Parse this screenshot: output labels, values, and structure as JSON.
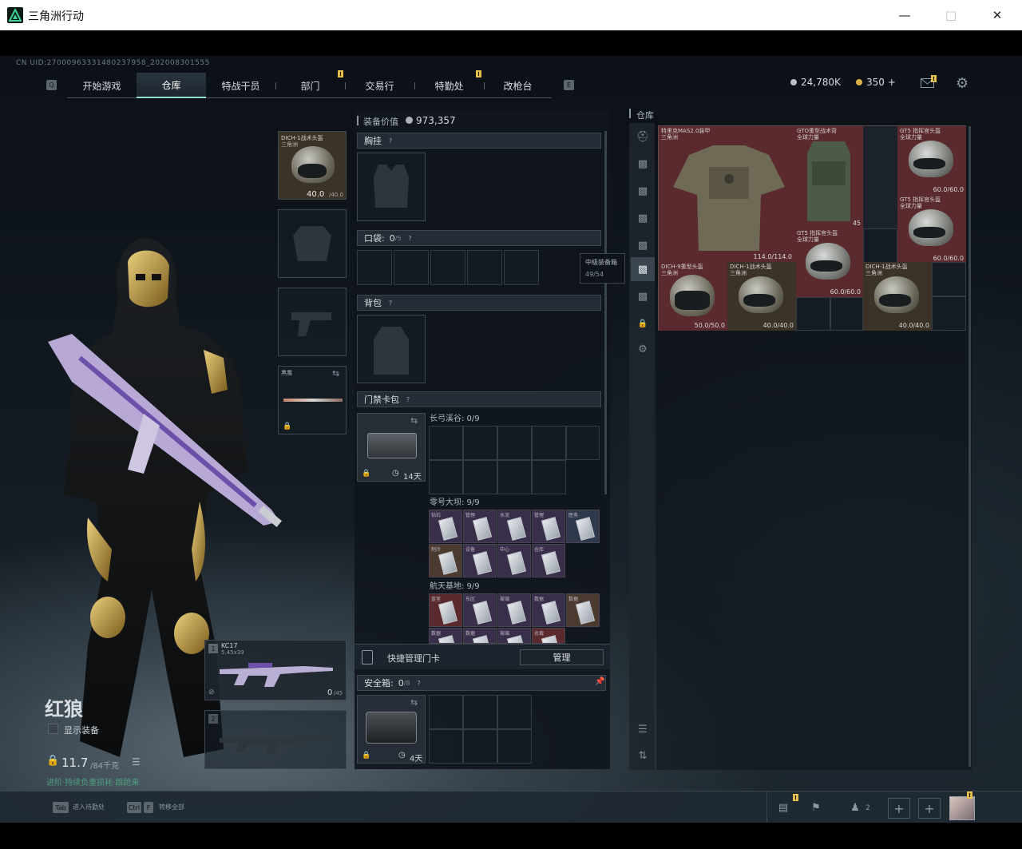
{
  "window": {
    "title": "三角洲行动"
  },
  "uid": "CN UID:27000963331480237958_202008301555",
  "nav": {
    "tabs": [
      {
        "label": "开始游戏",
        "active": false
      },
      {
        "label": "仓库",
        "active": true
      },
      {
        "label": "特战干员",
        "active": false
      },
      {
        "label": "部门",
        "active": false,
        "badge": "!"
      },
      {
        "label": "交易行",
        "active": false
      },
      {
        "label": "特勤处",
        "active": false,
        "badge": "!"
      },
      {
        "label": "改枪台",
        "active": false
      }
    ],
    "key_left": "Q",
    "key_right": "E"
  },
  "currency": {
    "silver": "24,780K",
    "gold": "350 +",
    "mail_badge": "!"
  },
  "operator": {
    "name": "红狼",
    "show_equipment": "显示装备",
    "weight": "11.7",
    "weight_max": "/84千克",
    "status": "进阶·持续负重损耗·踉跄来"
  },
  "equip": {
    "helmet": {
      "name": "DICH-1战术头盔",
      "sub": "三角洲",
      "durability": "40.0",
      "durability_max": "/40.0"
    },
    "melee": {
      "name": "黑鹰"
    },
    "primary": {
      "slot": "1",
      "name": "KC17",
      "caliber": "5.45x39",
      "ammo": "0",
      "ammo_max": "/45"
    },
    "secondary": {
      "slot": "2"
    }
  },
  "loadout": {
    "value_label": "装备价值",
    "value": "973,357",
    "chest_rig": "胸挂",
    "pocket_label": "口袋:",
    "pocket_count": "0",
    "pocket_max": "/5",
    "backpack": "背包",
    "keycard_label": "门禁卡包",
    "keycard_days": "14天",
    "map1": "长弓溪谷: 0/9",
    "map2": "零号大坝: 9/9",
    "map3": "航天基地: 9/9",
    "map2_cards": [
      "钻石",
      "管理",
      "水泥",
      "管理",
      "医务",
      "制冷",
      "设备",
      "中心",
      "仓库"
    ],
    "map3_cards": [
      "蓝室",
      "东区",
      "玻璃",
      "数据",
      "数据",
      "数据",
      "数据",
      "玻璃",
      "总裁"
    ],
    "quick_manage": "快捷管理门卡",
    "manage_btn": "管理",
    "safebox_label": "安全箱:",
    "safebox_count": "0",
    "safebox_max": "/8",
    "safebox_days": "4天"
  },
  "tooltip": {
    "title": "中级装备箱",
    "count": "49/54"
  },
  "stash": {
    "title": "仓库",
    "items": [
      {
        "name": "特里克MAS2.0装甲",
        "sub": "三角洲",
        "durability": ""
      },
      {
        "name": "GTO重型战术背",
        "sub": "全球力量",
        "durability": ""
      },
      {
        "name": "GT5 指挥官头盔",
        "sub": "全球力量",
        "durability": "60.0/60.0"
      },
      {
        "name": "GT5 指挥官头盔",
        "sub": "全球力量",
        "durability": "60.0/60.0"
      },
      {
        "name": "GT5 指挥官头盔",
        "sub": "全球力量",
        "durability": "60.0/60.0"
      },
      {
        "name": "DICH-9重型头盔",
        "sub": "三角洲",
        "durability": "50.0/50.0"
      },
      {
        "name": "DICH-1战术头盔",
        "sub": "三角洲",
        "durability": "40.0/40.0"
      },
      {
        "name": "DICH-1战术头盔",
        "sub": "三角洲",
        "durability": "40.0/40.0"
      }
    ],
    "armor_durability": "114.0/114.0",
    "backpack_count": "45"
  },
  "bottom": {
    "hint1_key": "Tab",
    "hint1": "进入待勤处",
    "hint2_key1": "Ctrl",
    "hint2_key2": "F",
    "hint2": "转移全部",
    "team_count": "2",
    "stats_badge": "!",
    "avatar_badge": "!"
  },
  "colors": {
    "accent": "#8ee1c8",
    "badge": "#e6c14c",
    "item_bg": "#5a2a2e"
  }
}
